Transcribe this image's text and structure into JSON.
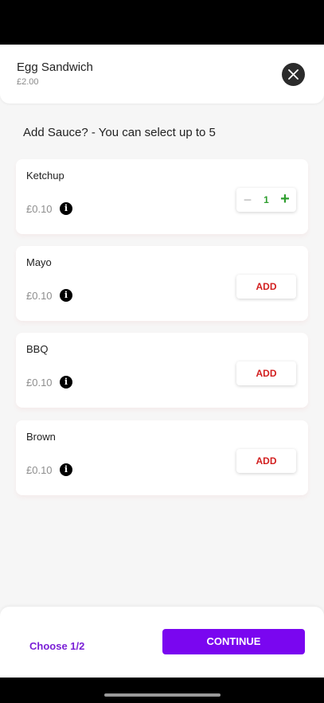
{
  "item": {
    "name": "Egg Sandwich",
    "price": "£2.00"
  },
  "header": {
    "close_icon": "close-icon"
  },
  "section": {
    "title": "Add Sauce? - You can select up to 5"
  },
  "options": [
    {
      "name": "Ketchup",
      "price": "£0.10",
      "info_glyph": "i",
      "state": "stepper",
      "quantity": "1",
      "minus": "−",
      "plus": "+"
    },
    {
      "name": "Mayo",
      "price": "£0.10",
      "info_glyph": "i",
      "state": "add",
      "add_label": "ADD"
    },
    {
      "name": "BBQ",
      "price": "£0.10",
      "info_glyph": "i",
      "state": "add",
      "add_label": "ADD"
    },
    {
      "name": "Brown",
      "price": "£0.10",
      "info_glyph": "i",
      "state": "add",
      "add_label": "ADD"
    }
  ],
  "footer": {
    "step_label": "Choose 1/2",
    "continue_label": "CONTINUE"
  },
  "colors": {
    "accent": "#7a06f0",
    "add_text": "#d21f1f",
    "stepper_green": "#2e9e2e"
  }
}
